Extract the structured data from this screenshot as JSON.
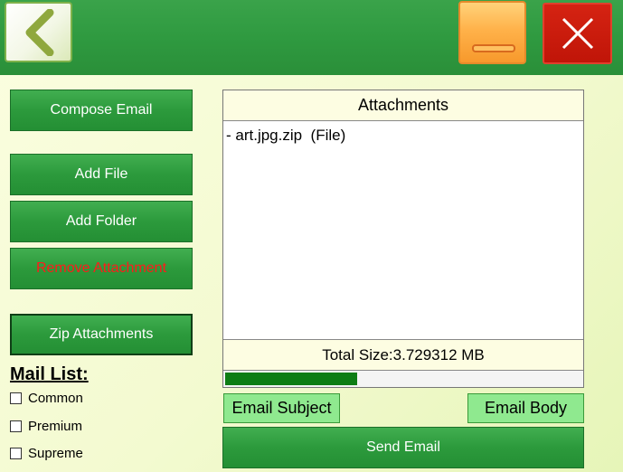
{
  "header": {
    "back_icon": "chevron-left-icon",
    "minimize_icon": "minimize-icon",
    "close_icon": "close-icon",
    "colors": {
      "header": "#2f9a40",
      "minimize": "#ffb24a",
      "close": "#c01508"
    }
  },
  "sidebar": {
    "compose_label": "Compose Email",
    "add_file_label": "Add File",
    "add_folder_label": "Add Folder",
    "remove_label": "Remove Attachment",
    "zip_label": "Zip Attachments",
    "remove_color": "#ff1a1a"
  },
  "mail_list": {
    "title": "Mail List:",
    "options": [
      {
        "label": "Common",
        "checked": false
      },
      {
        "label": "Premium",
        "checked": false
      },
      {
        "label": "Supreme",
        "checked": false
      }
    ]
  },
  "attachments": {
    "title": "Attachments",
    "items": [
      "- art.jpg.zip  (File)"
    ],
    "total_size": "Total Size:3.729312 MB",
    "progress": 0.37,
    "progress_color": "#0d7d14"
  },
  "actions": {
    "subject_label": "Email Subject",
    "body_label": "Email Body",
    "send_label": "Send Email"
  }
}
